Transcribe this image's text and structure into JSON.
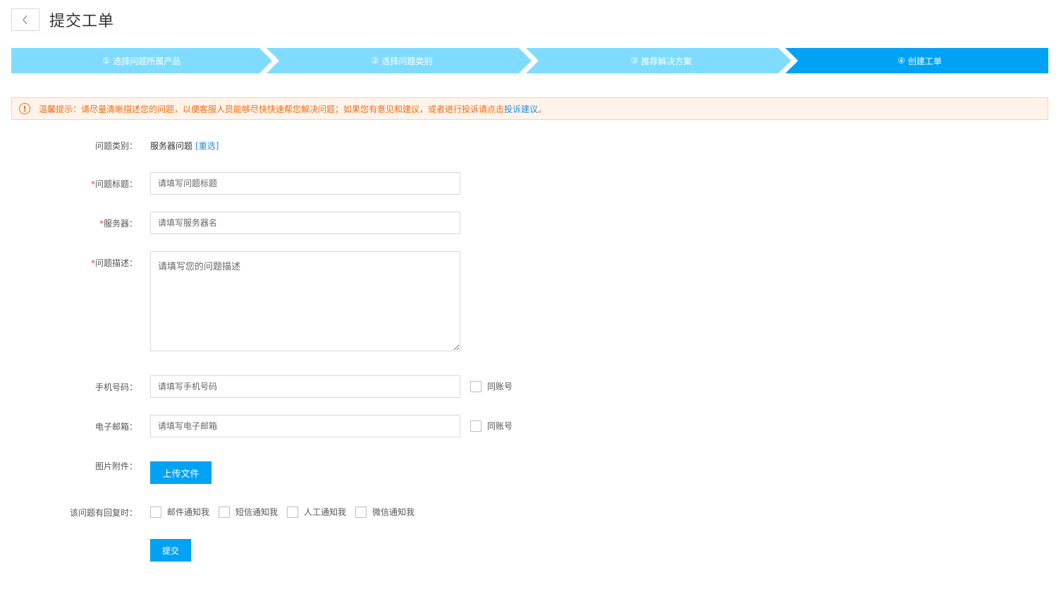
{
  "header": {
    "title": "提交工单",
    "back_icon": "chevron-left-icon"
  },
  "steps": [
    {
      "number": "①",
      "label": "选择问题所属产品",
      "active": false
    },
    {
      "number": "②",
      "label": "选择问题类别",
      "active": false
    },
    {
      "number": "③",
      "label": "推荐解决方案",
      "active": false
    },
    {
      "number": "④",
      "label": "创建工单",
      "active": true
    }
  ],
  "colors": {
    "step_inactive": "#80dcff",
    "step_active": "#00a2f3",
    "accent": "#00a2f3",
    "warning": "#ef6e1a",
    "link": "#1e8fe1"
  },
  "tip": {
    "icon": "exclamation-circle-icon",
    "text": "温馨提示：请尽量清晰描述您的问题，以便客服人员能够尽快快速帮您解决问题；如果您有意见和建议，或者进行投诉请点击",
    "link_text": "投诉建议",
    "suffix": "。"
  },
  "form": {
    "category": {
      "label": "问题类别：",
      "value": "服务器问题",
      "reselect": "[重选]"
    },
    "title": {
      "required": "*",
      "label": "问题标题：",
      "placeholder": "请填写问题标题"
    },
    "server": {
      "required": "*",
      "label": "服务器：",
      "placeholder": "请填写服务器名"
    },
    "description": {
      "required": "*",
      "label": "问题描述：",
      "placeholder": "请填写您的问题描述"
    },
    "phone": {
      "label": "手机号码：",
      "placeholder": "请填写手机号码",
      "same_account": "同账号"
    },
    "email": {
      "label": "电子邮箱：",
      "placeholder": "请填写电子邮箱",
      "same_account": "同账号"
    },
    "attachment": {
      "label": "图片附件：",
      "button": "上传文件"
    },
    "notify": {
      "label": "该问题有回复时：",
      "options": [
        "邮件通知我",
        "短信通知我",
        "人工通知我",
        "微信通知我"
      ]
    },
    "submit": "提交"
  }
}
